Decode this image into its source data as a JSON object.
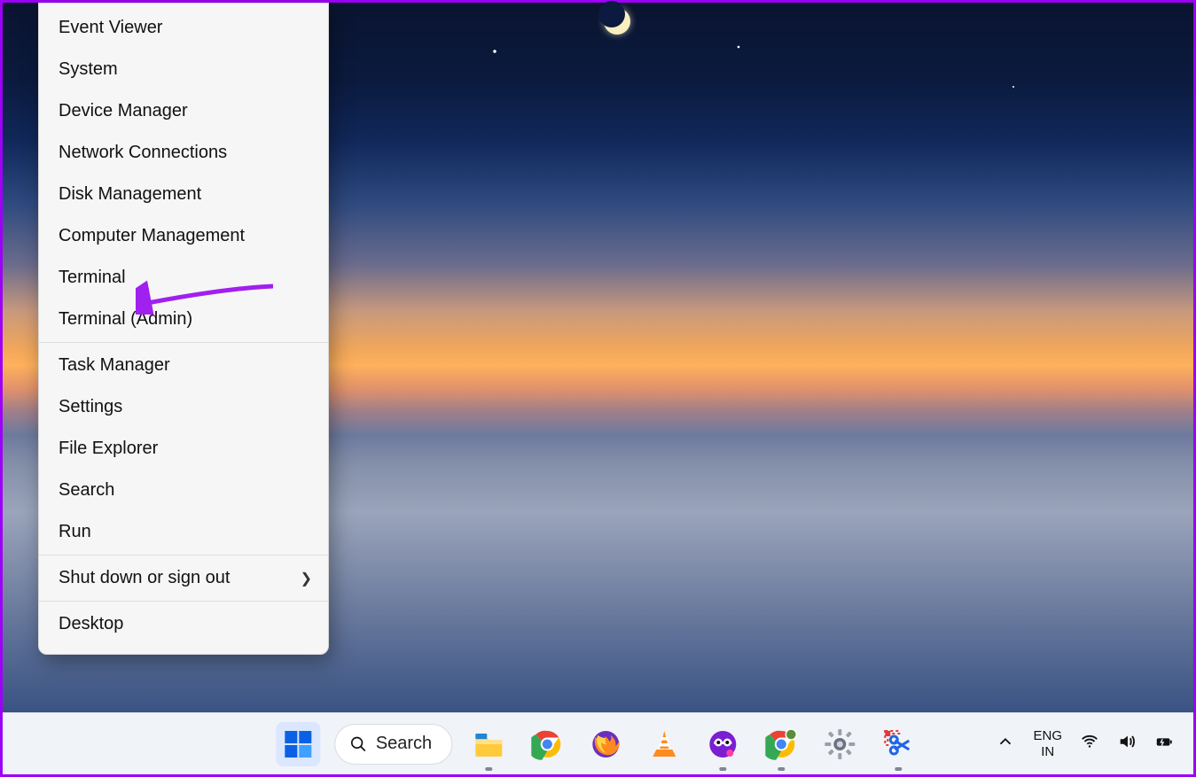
{
  "context_menu": {
    "groups": [
      [
        "Event Viewer",
        "System",
        "Device Manager",
        "Network Connections",
        "Disk Management",
        "Computer Management",
        "Terminal",
        "Terminal (Admin)"
      ],
      [
        "Task Manager",
        "Settings",
        "File Explorer",
        "Search",
        "Run"
      ],
      [
        "Shut down or sign out"
      ],
      [
        "Desktop"
      ]
    ],
    "submenu_label": "Shut down or sign out"
  },
  "annotation": {
    "points_to": "Terminal"
  },
  "taskbar": {
    "search_label": "Search",
    "icons": [
      {
        "id": "start",
        "name": "start-button",
        "running": false
      },
      {
        "id": "search",
        "name": "search-pill",
        "running": false
      },
      {
        "id": "explorer",
        "name": "file-explorer-icon",
        "running": true
      },
      {
        "id": "chrome",
        "name": "chrome-icon",
        "running": false
      },
      {
        "id": "firefox",
        "name": "firefox-icon",
        "running": false
      },
      {
        "id": "vlc",
        "name": "vlc-icon",
        "running": false
      },
      {
        "id": "app-purple",
        "name": "purple-app-icon",
        "running": true
      },
      {
        "id": "chrome-profile",
        "name": "chrome-profile-icon",
        "running": true
      },
      {
        "id": "settings",
        "name": "settings-icon",
        "running": false
      },
      {
        "id": "snip",
        "name": "snipping-tool-icon",
        "running": true
      }
    ]
  },
  "tray": {
    "lang_top": "ENG",
    "lang_bottom": "IN"
  }
}
